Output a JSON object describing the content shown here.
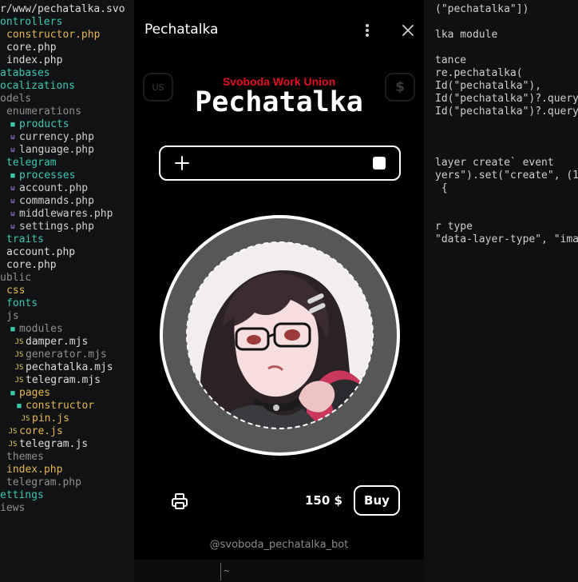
{
  "editor": {
    "path": "r/www/pechatalka.svo",
    "tree": [
      {
        "label": "ontrollers",
        "kind": "folder-root",
        "indent": 0
      },
      {
        "label": "constructor.php",
        "kind": "mod",
        "indent": 1
      },
      {
        "label": "core.php",
        "kind": "file",
        "indent": 1
      },
      {
        "label": "index.php",
        "kind": "file",
        "indent": 1
      },
      {
        "label": "atabases",
        "kind": "folder-root",
        "indent": 0
      },
      {
        "label": "ocalizations",
        "kind": "folder-root",
        "indent": 0
      },
      {
        "label": "odels",
        "kind": "folder-root-dim",
        "indent": 0
      },
      {
        "label": "enumerations",
        "kind": "faded",
        "indent": 1
      },
      {
        "label": "products",
        "kind": "folder",
        "indent": 1
      },
      {
        "label": "currency.php",
        "kind": "php",
        "indent": 1
      },
      {
        "label": "language.php",
        "kind": "php",
        "indent": 1
      },
      {
        "label": "telegram",
        "kind": "folder-plain",
        "indent": 1
      },
      {
        "label": "processes",
        "kind": "folder",
        "indent": 1
      },
      {
        "label": "account.php",
        "kind": "php",
        "indent": 1
      },
      {
        "label": "commands.php",
        "kind": "php",
        "indent": 1
      },
      {
        "label": "middlewares.php",
        "kind": "php",
        "indent": 1
      },
      {
        "label": "settings.php",
        "kind": "php",
        "indent": 1
      },
      {
        "label": "traits",
        "kind": "folder-plain",
        "indent": 1
      },
      {
        "label": "account.php",
        "kind": "file",
        "indent": 1
      },
      {
        "label": "core.php",
        "kind": "file",
        "indent": 1
      },
      {
        "label": "ublic",
        "kind": "faded",
        "indent": 0
      },
      {
        "label": "css",
        "kind": "mod",
        "indent": 1
      },
      {
        "label": "fonts",
        "kind": "folder-plain",
        "indent": 1
      },
      {
        "label": "js",
        "kind": "faded",
        "indent": 1
      },
      {
        "label": "modules",
        "kind": "folder-faded",
        "indent": 1
      },
      {
        "label": "damper.mjs",
        "kind": "js",
        "indent": 2
      },
      {
        "label": "generator.mjs",
        "kind": "js-faded",
        "indent": 2
      },
      {
        "label": "pechatalka.mjs",
        "kind": "js",
        "indent": 2
      },
      {
        "label": "telegram.mjs",
        "kind": "js",
        "indent": 2
      },
      {
        "label": "pages",
        "kind": "folder-mod",
        "indent": 1
      },
      {
        "label": "constructor",
        "kind": "folder-mod",
        "indent": 2
      },
      {
        "label": "pin.js",
        "kind": "js-mod",
        "indent": 3
      },
      {
        "label": "core.js",
        "kind": "js-mod",
        "indent": 1
      },
      {
        "label": "telegram.js",
        "kind": "js",
        "indent": 1
      },
      {
        "label": "themes",
        "kind": "faded",
        "indent": 1
      },
      {
        "label": "index.php",
        "kind": "mod",
        "indent": 1
      },
      {
        "label": "telegram.php",
        "kind": "faded",
        "indent": 1
      },
      {
        "label": "ettings",
        "kind": "folder-root",
        "indent": 0
      },
      {
        "label": "iews",
        "kind": "faded",
        "indent": 0
      }
    ],
    "code": [
      {
        "row": 0,
        "text": "(\"pechatalka\"])"
      },
      {
        "row": 2,
        "text": "lka module"
      },
      {
        "row": 4,
        "text": "tance"
      },
      {
        "row": 5,
        "text": "re.pechatalka("
      },
      {
        "row": 6,
        "text": "Id(\"pechatalka\"),"
      },
      {
        "row": 7,
        "text": "Id(\"pechatalka\")?.query"
      },
      {
        "row": 8,
        "text": "Id(\"pechatalka\")?.query"
      },
      {
        "row": 12,
        "text": "layer create` event"
      },
      {
        "row": 13,
        "text": "yers\").set(\"create\", (1"
      },
      {
        "row": 14,
        "text": " {"
      },
      {
        "row": 17,
        "text": "r type"
      },
      {
        "row": 18,
        "text": "\"data-layer-type\", \"ima"
      }
    ],
    "terminal": "~"
  },
  "popup": {
    "title": "Pechatalka",
    "menu_icon": "more-vertical-icon",
    "close_icon": "close-icon",
    "left_button": "US",
    "right_button": "$",
    "brand_subtitle": "Svoboda Work Union",
    "brand_title": "Pechatalka",
    "input": {
      "value": "",
      "plus_icon": "plus-icon",
      "stop_icon": "stop-icon"
    },
    "pin": {
      "ring_color": "#575757",
      "border_color": "#ffffff"
    },
    "price": "150 $",
    "buy_label": "Buy",
    "print_icon": "printer-icon",
    "bot_name": "@svoboda_pechatalka_bot"
  },
  "colors": {
    "accent_red": "#e0101c",
    "background": "#000000",
    "folder": "#3cc8b0",
    "modified": "#e6b450"
  }
}
